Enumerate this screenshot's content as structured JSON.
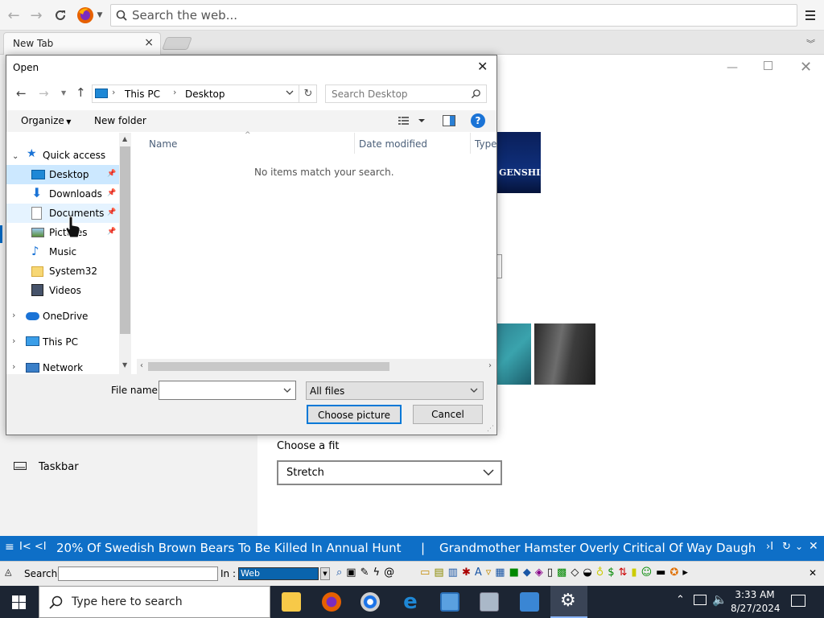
{
  "browser": {
    "search_placeholder": "Search the web...",
    "tab_label": "New Tab",
    "tab_close": "×"
  },
  "settings": {
    "taskbar_label": "Taskbar",
    "fit_label": "Choose a fit",
    "fit_value": "Stretch",
    "genshin_text": "GENSHIN"
  },
  "dialog": {
    "title": "Open",
    "breadcrumb": [
      "This PC",
      "Desktop"
    ],
    "search_placeholder": "Search Desktop",
    "organize_label": "Organize",
    "new_folder_label": "New folder",
    "nav_items": [
      {
        "label": "Quick access",
        "icon": "star-icon"
      },
      {
        "label": "Desktop",
        "icon": "desktop-icon",
        "pinned": true,
        "selected": true
      },
      {
        "label": "Downloads",
        "icon": "download-icon",
        "pinned": true
      },
      {
        "label": "Documents",
        "icon": "documents-icon",
        "pinned": true
      },
      {
        "label": "Pictures",
        "icon": "pictures-icon",
        "pinned": true
      },
      {
        "label": "Music",
        "icon": "music-icon"
      },
      {
        "label": "System32",
        "icon": "folder-icon"
      },
      {
        "label": "Videos",
        "icon": "video-icon"
      },
      {
        "label": "OneDrive",
        "icon": "cloud-icon"
      },
      {
        "label": "This PC",
        "icon": "computer-icon"
      },
      {
        "label": "Network",
        "icon": "network-icon"
      }
    ],
    "columns": [
      "Name",
      "Date modified",
      "Type"
    ],
    "empty_message": "No items match your search.",
    "file_name_label": "File name:",
    "file_name_value": "",
    "file_type_value": "All files",
    "choose_button": "Choose picture",
    "cancel_button": "Cancel"
  },
  "ticker": {
    "headline1": "20% Of Swedish Brown Bears To Be Killed In Annual Hunt",
    "separator": "|",
    "headline2": "Grandmother Hamster Overly Critical Of Way Daugh"
  },
  "searchbar": {
    "search_label": "Search :",
    "in_label": "In :",
    "in_value": "Web"
  },
  "taskbar": {
    "search_placeholder": "Type here to search",
    "time": "3:33 AM",
    "date": "8/27/2024"
  }
}
